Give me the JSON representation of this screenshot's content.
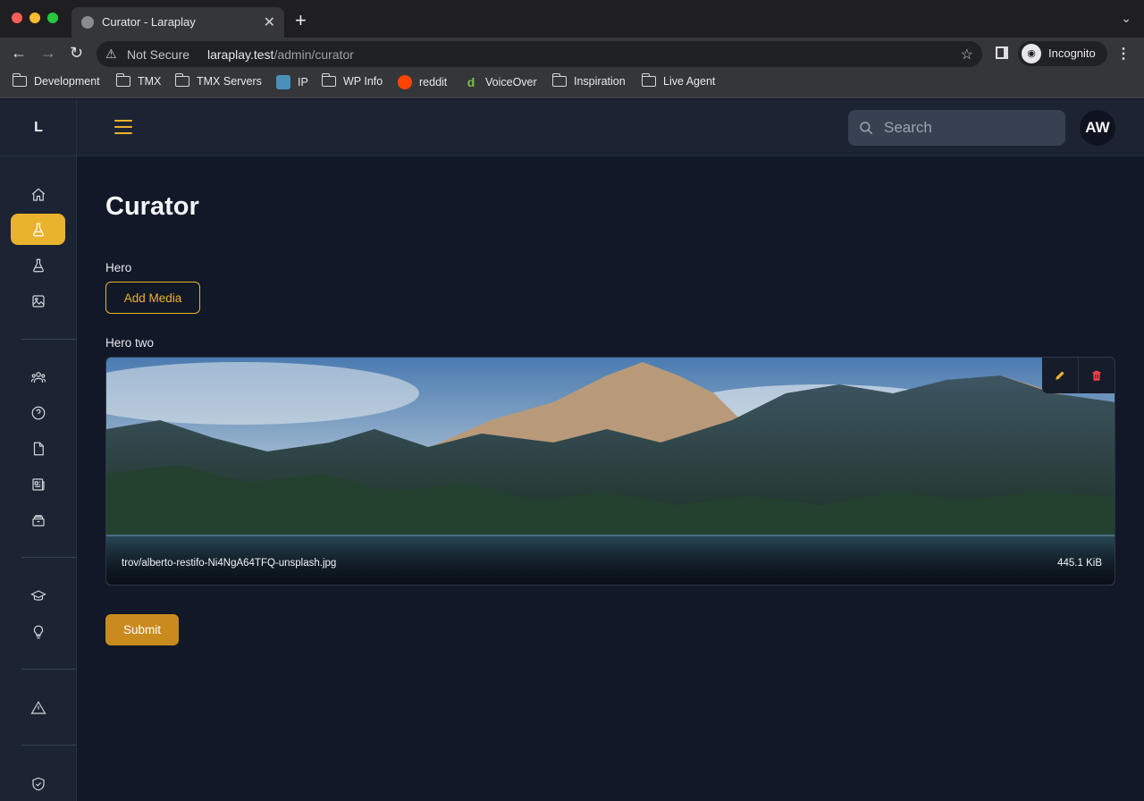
{
  "browser": {
    "tab_title": "Curator - Laraplay",
    "security_label": "Not Secure",
    "url_host": "laraplay.test",
    "url_path": "/admin/curator",
    "profile_label": "Incognito",
    "bookmarks": [
      "Development",
      "TMX",
      "TMX Servers",
      "IP",
      "WP Info",
      "reddit",
      "VoiceOver",
      "Inspiration",
      "Live Agent"
    ]
  },
  "app": {
    "logo_letter": "L",
    "search_placeholder": "Search",
    "user_initials": "AW",
    "page_title": "Curator",
    "fields": {
      "hero_label": "Hero",
      "add_media_label": "Add Media",
      "hero_two_label": "Hero two"
    },
    "media": {
      "filename": "trov/alberto-restifo-Ni4NgA64TFQ-unsplash.jpg",
      "size": "445.1 KiB"
    },
    "submit_label": "Submit",
    "colors": {
      "accent": "#eab32d",
      "background": "#111827",
      "danger": "#ef4444"
    }
  }
}
